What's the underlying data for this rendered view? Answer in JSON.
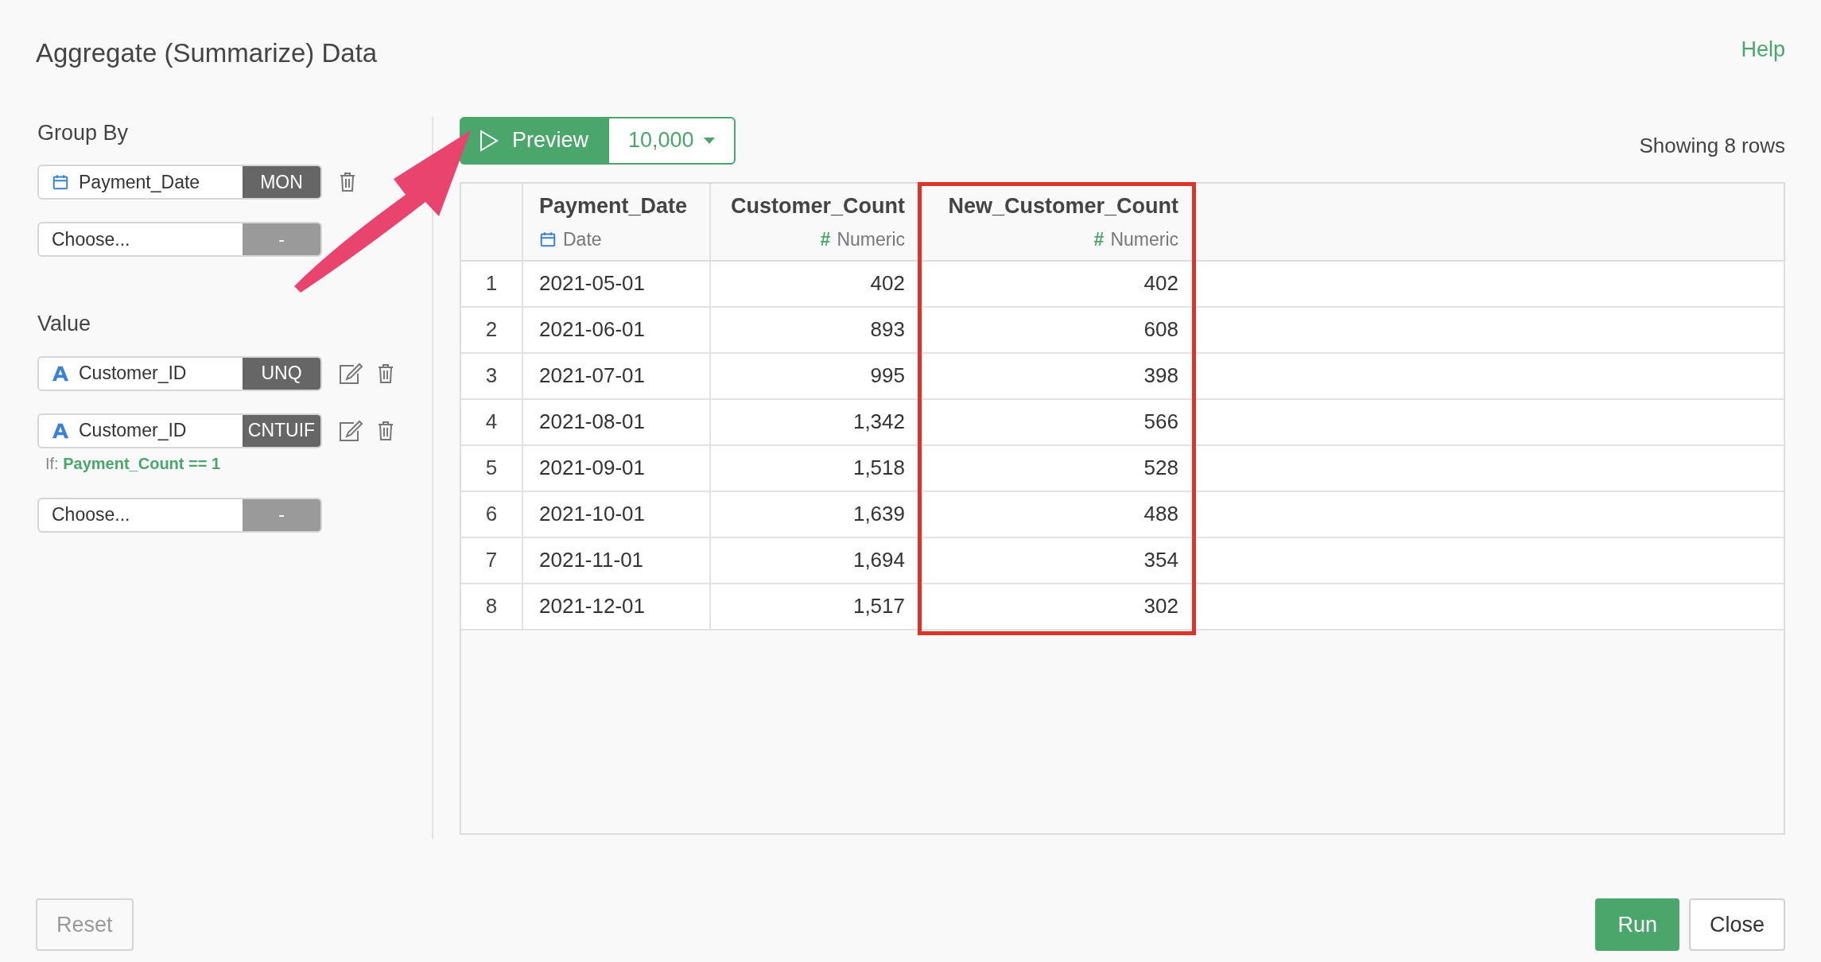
{
  "dialog": {
    "title": "Aggregate (Summarize) Data",
    "help": "Help"
  },
  "group_by": {
    "label": "Group By",
    "items": [
      {
        "kind": "date",
        "name": "Payment_Date",
        "badge": "MON",
        "editable": false
      },
      {
        "kind": "empty",
        "name": "Choose...",
        "badge": "-"
      }
    ]
  },
  "value": {
    "label": "Value",
    "items": [
      {
        "kind": "text",
        "name": "Customer_ID",
        "badge": "UNQ",
        "editable": true
      },
      {
        "kind": "text",
        "name": "Customer_ID",
        "badge": "CNTUIF",
        "editable": true,
        "condition": {
          "label": "If:",
          "expr": "Payment_Count == 1"
        }
      },
      {
        "kind": "empty",
        "name": "Choose...",
        "badge": "-"
      }
    ]
  },
  "preview": {
    "label": "Preview",
    "limit": "10,000"
  },
  "showing": "Showing 8 rows",
  "table": {
    "columns": [
      {
        "name": "Payment_Date",
        "kind": "date",
        "type_label": "Date",
        "highlighted": false
      },
      {
        "name": "Customer_Count",
        "kind": "numeric",
        "type_symbol": "#",
        "type_label": "Numeric",
        "highlighted": false
      },
      {
        "name": "New_Customer_Count",
        "kind": "numeric",
        "type_symbol": "#",
        "type_label": "Numeric",
        "highlighted": true
      }
    ],
    "rows": [
      {
        "index": "1",
        "cells": [
          "2021-05-01",
          "402",
          "402"
        ]
      },
      {
        "index": "2",
        "cells": [
          "2021-06-01",
          "893",
          "608"
        ]
      },
      {
        "index": "3",
        "cells": [
          "2021-07-01",
          "995",
          "398"
        ]
      },
      {
        "index": "4",
        "cells": [
          "2021-08-01",
          "1,342",
          "566"
        ]
      },
      {
        "index": "5",
        "cells": [
          "2021-09-01",
          "1,518",
          "528"
        ]
      },
      {
        "index": "6",
        "cells": [
          "2021-10-01",
          "1,639",
          "488"
        ]
      },
      {
        "index": "7",
        "cells": [
          "2021-11-01",
          "1,694",
          "354"
        ]
      },
      {
        "index": "8",
        "cells": [
          "2021-12-01",
          "1,517",
          "302"
        ]
      }
    ]
  },
  "footer": {
    "reset": "Reset",
    "run": "Run",
    "close": "Close"
  }
}
